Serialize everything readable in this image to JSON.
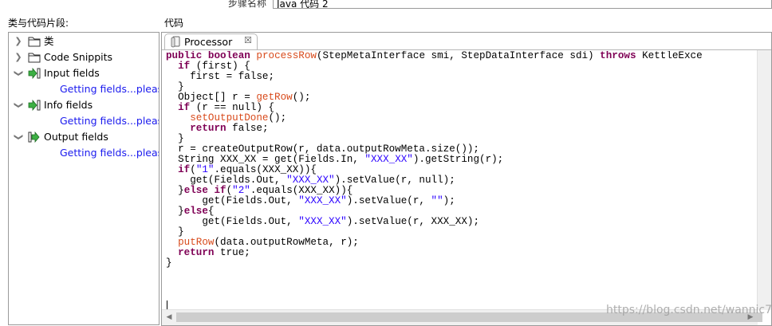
{
  "step": {
    "label": "步骤名称",
    "value": "Java 代码 2"
  },
  "left_panel": {
    "heading": "类与代码片段:",
    "items": [
      {
        "label": "类",
        "icon": "folder-icon",
        "expanded": false
      },
      {
        "label": "Code Snippits",
        "icon": "folder-icon",
        "expanded": false
      },
      {
        "label": "Input fields",
        "icon": "input-fields-icon",
        "expanded": true,
        "child": "Getting fields...please wait"
      },
      {
        "label": "Info fields",
        "icon": "input-fields-icon",
        "expanded": true,
        "child": "Getting fields...please wait"
      },
      {
        "label": "Output fields",
        "icon": "output-fields-icon",
        "expanded": true,
        "child": "Getting fields...please wait"
      }
    ]
  },
  "editor": {
    "heading": "代码",
    "tab_label": "Processor",
    "colors": {
      "keyword": "#7f0055",
      "method": "#d84a1b",
      "string": "#2a00ff"
    },
    "code_lines": [
      [
        [
          "k",
          "public"
        ],
        [
          "t",
          " "
        ],
        [
          "k",
          "boolean"
        ],
        [
          "t",
          " "
        ],
        [
          "f",
          "processRow"
        ],
        [
          "t",
          "(StepMetaInterface smi, StepDataInterface sdi) "
        ],
        [
          "k",
          "throws"
        ],
        [
          "t",
          " KettleExce"
        ]
      ],
      [
        [
          "t",
          "  "
        ],
        [
          "k",
          "if"
        ],
        [
          "t",
          " (first) {"
        ]
      ],
      [
        [
          "t",
          "    first = false;"
        ]
      ],
      [
        [
          "t",
          "  }"
        ]
      ],
      [
        [
          "t",
          "  Object[] r = "
        ],
        [
          "f",
          "getRow"
        ],
        [
          "t",
          "();"
        ]
      ],
      [
        [
          "t",
          "  "
        ],
        [
          "k",
          "if"
        ],
        [
          "t",
          " (r == null) {"
        ]
      ],
      [
        [
          "t",
          "    "
        ],
        [
          "f",
          "setOutputDone"
        ],
        [
          "t",
          "();"
        ]
      ],
      [
        [
          "t",
          "    "
        ],
        [
          "k",
          "return"
        ],
        [
          "t",
          " false;"
        ]
      ],
      [
        [
          "t",
          "  }"
        ]
      ],
      [
        [
          "t",
          "  r = createOutputRow(r, data.outputRowMeta.size());"
        ]
      ],
      [
        [
          "t",
          "  String XXX_XX = get(Fields.In, "
        ],
        [
          "s",
          "\"XXX_XX\""
        ],
        [
          "t",
          ").getString(r);"
        ]
      ],
      [
        [
          "t",
          "  "
        ],
        [
          "k",
          "if"
        ],
        [
          "t",
          "("
        ],
        [
          "s",
          "\"1\""
        ],
        [
          "t",
          ".equals(XXX_XX)){"
        ]
      ],
      [
        [
          "t",
          "    get(Fields.Out, "
        ],
        [
          "s",
          "\"XXX_XX\""
        ],
        [
          "t",
          ").setValue(r, null);"
        ]
      ],
      [
        [
          "t",
          "  }"
        ],
        [
          "k",
          "else if"
        ],
        [
          "t",
          "("
        ],
        [
          "s",
          "\"2\""
        ],
        [
          "t",
          ".equals(XXX_XX)){"
        ]
      ],
      [
        [
          "t",
          "      get(Fields.Out, "
        ],
        [
          "s",
          "\"XXX_XX\""
        ],
        [
          "t",
          ").setValue(r, "
        ],
        [
          "s",
          "\"\""
        ],
        [
          "t",
          ");"
        ]
      ],
      [
        [
          "t",
          "  }"
        ],
        [
          "k",
          "else"
        ],
        [
          "t",
          "{"
        ]
      ],
      [
        [
          "t",
          "      get(Fields.Out, "
        ],
        [
          "s",
          "\"XXX_XX\""
        ],
        [
          "t",
          ").setValue(r, XXX_XX);"
        ]
      ],
      [
        [
          "t",
          "  }"
        ]
      ],
      [
        [
          "t",
          "  "
        ],
        [
          "f",
          "putRow"
        ],
        [
          "t",
          "(data.outputRowMeta, r);"
        ]
      ],
      [
        [
          "t",
          "  "
        ],
        [
          "k",
          "return"
        ],
        [
          "t",
          " true;"
        ]
      ],
      [
        [
          "t",
          "}"
        ]
      ]
    ]
  },
  "watermark": "https://blog.csdn.net/wannic7"
}
